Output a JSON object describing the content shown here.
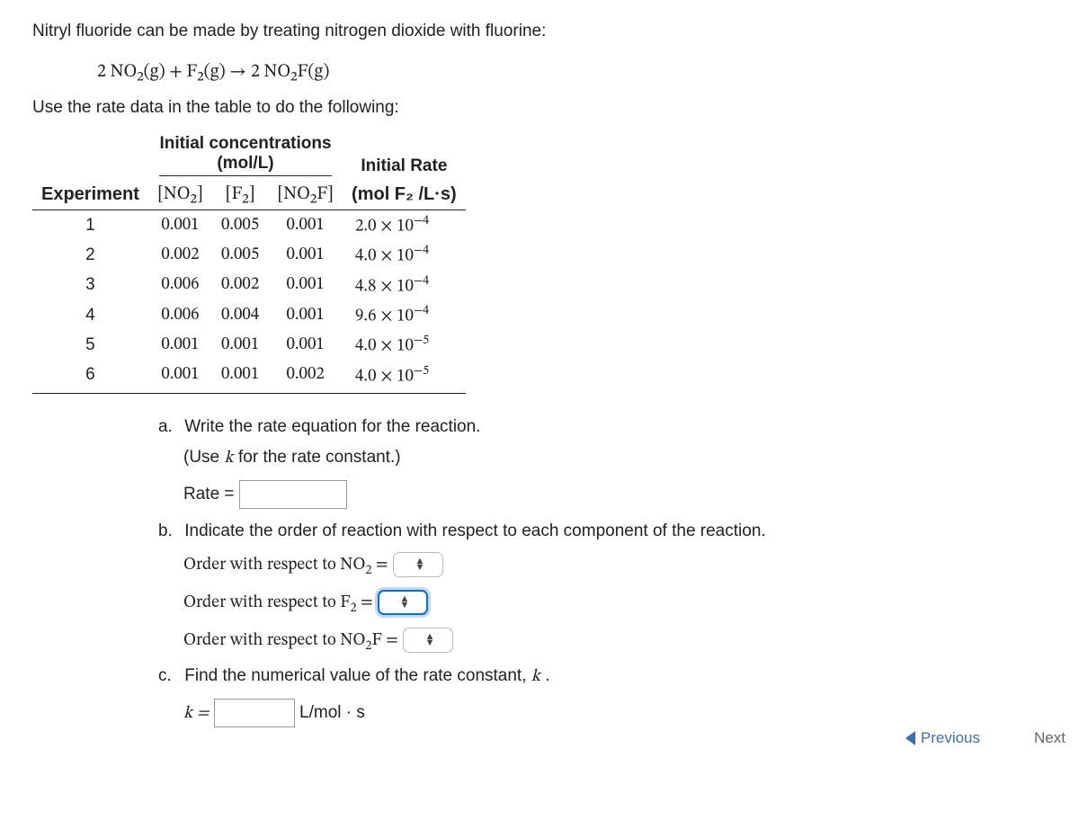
{
  "intro": "Nitryl fluoride can be made by treating nitrogen dioxide with fluorine:",
  "equation": "2 NO₂(g) + F₂(g)  →  2 NO₂F(g)",
  "instruction": "Use the rate data in the table to do the following:",
  "table": {
    "group_header_top": "Initial concentrations",
    "group_header_bottom": "(mol/L)",
    "rate_header": "Initial Rate",
    "cols": {
      "exp": "Experiment",
      "no2": "[NO₂]",
      "f2": "[F₂]",
      "no2f": "[NO₂F]",
      "rate": "(mol F₂ /L·s)"
    },
    "rows": [
      {
        "exp": "1",
        "no2": "0.001",
        "f2": "0.005",
        "no2f": "0.001",
        "rate_m": "2.0 × 10",
        "rate_e": "−4"
      },
      {
        "exp": "2",
        "no2": "0.002",
        "f2": "0.005",
        "no2f": "0.001",
        "rate_m": "4.0 × 10",
        "rate_e": "−4"
      },
      {
        "exp": "3",
        "no2": "0.006",
        "f2": "0.002",
        "no2f": "0.001",
        "rate_m": "4.8 × 10",
        "rate_e": "−4"
      },
      {
        "exp": "4",
        "no2": "0.006",
        "f2": "0.004",
        "no2f": "0.001",
        "rate_m": "9.6 × 10",
        "rate_e": "−4"
      },
      {
        "exp": "5",
        "no2": "0.001",
        "f2": "0.001",
        "no2f": "0.001",
        "rate_m": "4.0 × 10",
        "rate_e": "−5"
      },
      {
        "exp": "6",
        "no2": "0.001",
        "f2": "0.001",
        "no2f": "0.002",
        "rate_m": "4.0 × 10",
        "rate_e": "−5"
      }
    ]
  },
  "parts": {
    "a_label": "a.",
    "a_text": "Write the rate equation for the reaction.",
    "a_hint": "(Use k for the rate constant.)",
    "a_prefix": "Rate =",
    "b_label": "b.",
    "b_text": "Indicate the order of reaction with respect to each component of the reaction.",
    "b_no2": "Order with respect to NO₂ =",
    "b_f2": "Order with respect to F₂ =",
    "b_no2f": "Order with respect to NO₂F =",
    "c_label": "c.",
    "c_text": "Find the numerical value of the rate constant, k .",
    "c_prefix": "k =",
    "c_unit": "L/mol · s"
  },
  "nav": {
    "prev": "Previous",
    "next": "Next"
  }
}
